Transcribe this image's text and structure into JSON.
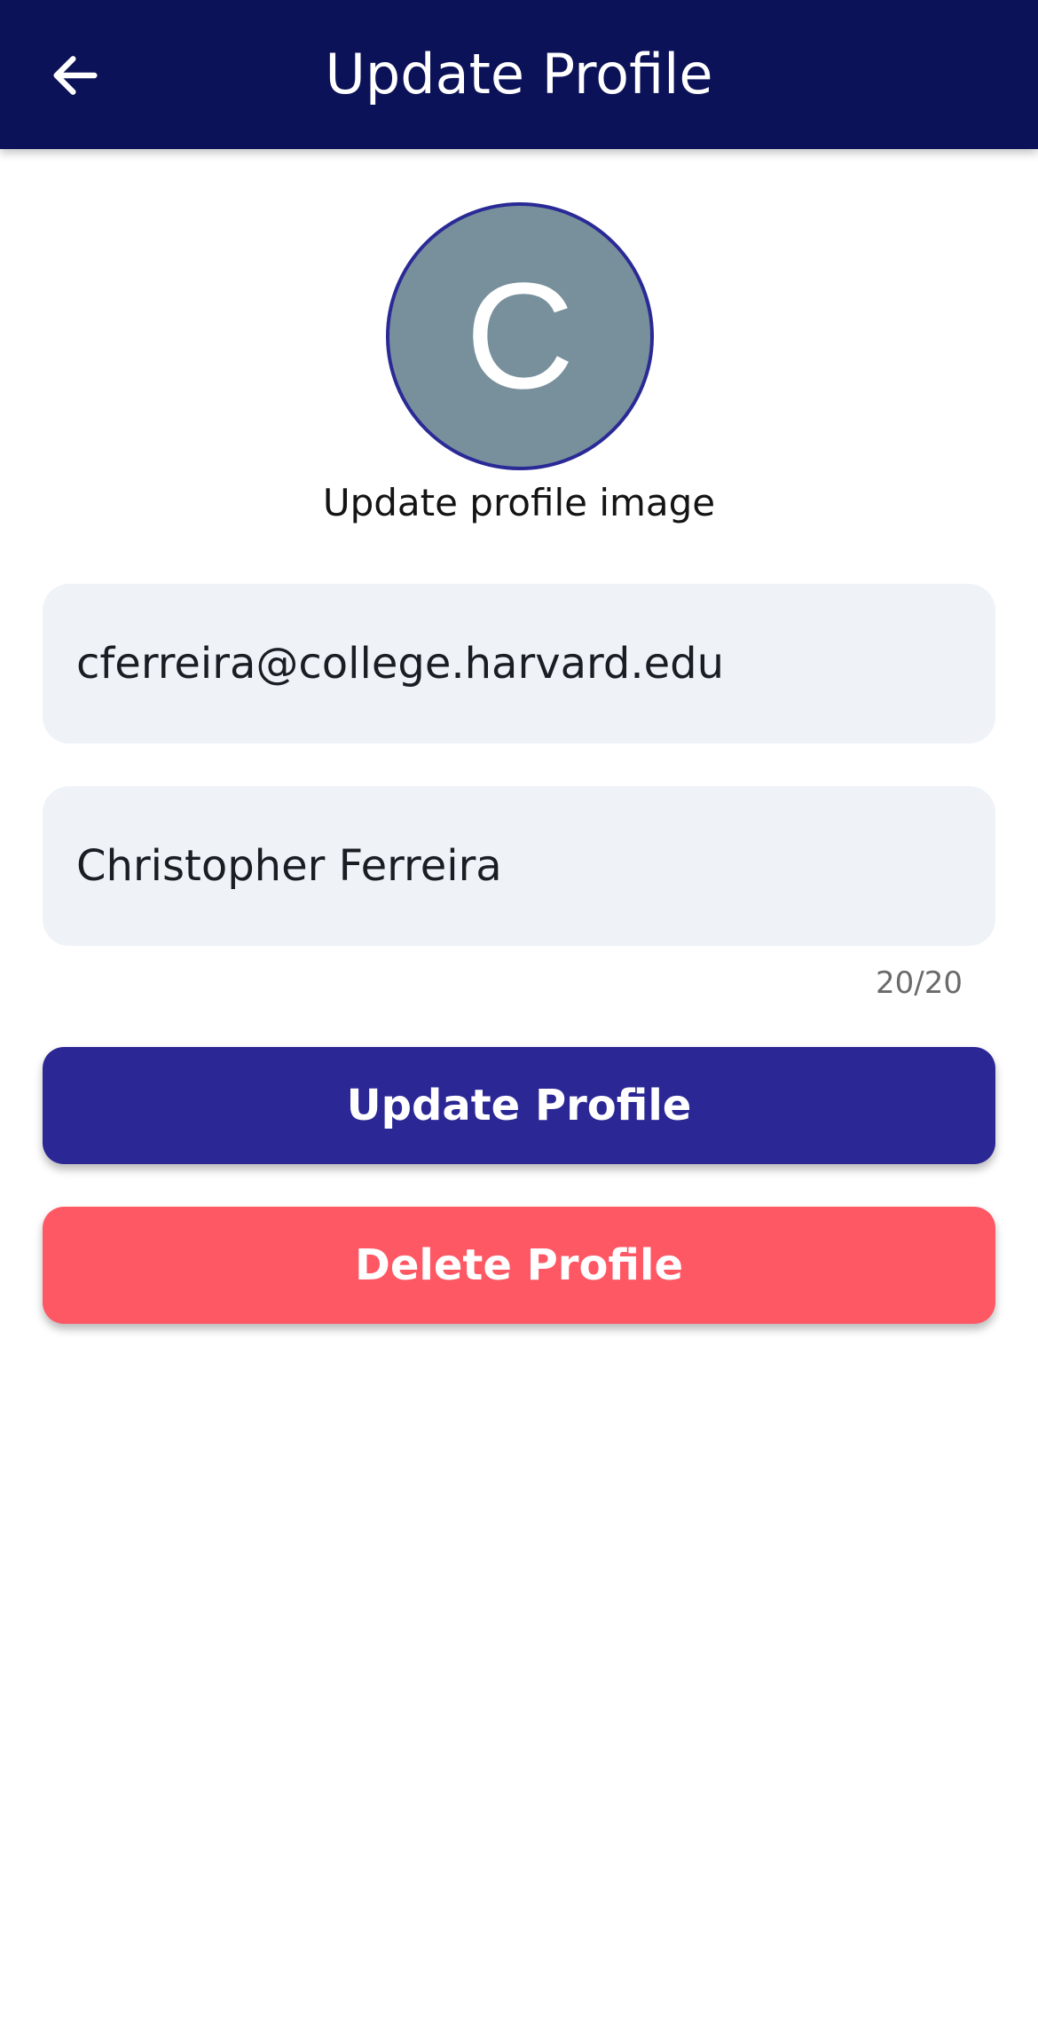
{
  "header": {
    "title": "Update Profile",
    "back_icon": "arrow-left-icon",
    "background_color": "#0b1257"
  },
  "avatar": {
    "initial": "C",
    "background_color": "#78909c",
    "border_color": "#2a2a96",
    "caption": "Update profile image"
  },
  "form": {
    "email_value": "cferreira@college.harvard.edu",
    "name_value": "Christopher Ferreira",
    "name_counter": "20/20"
  },
  "actions": {
    "update_label": "Update Profile",
    "update_color": "#2b2795",
    "delete_label": "Delete Profile",
    "delete_color": "#ff5865"
  }
}
